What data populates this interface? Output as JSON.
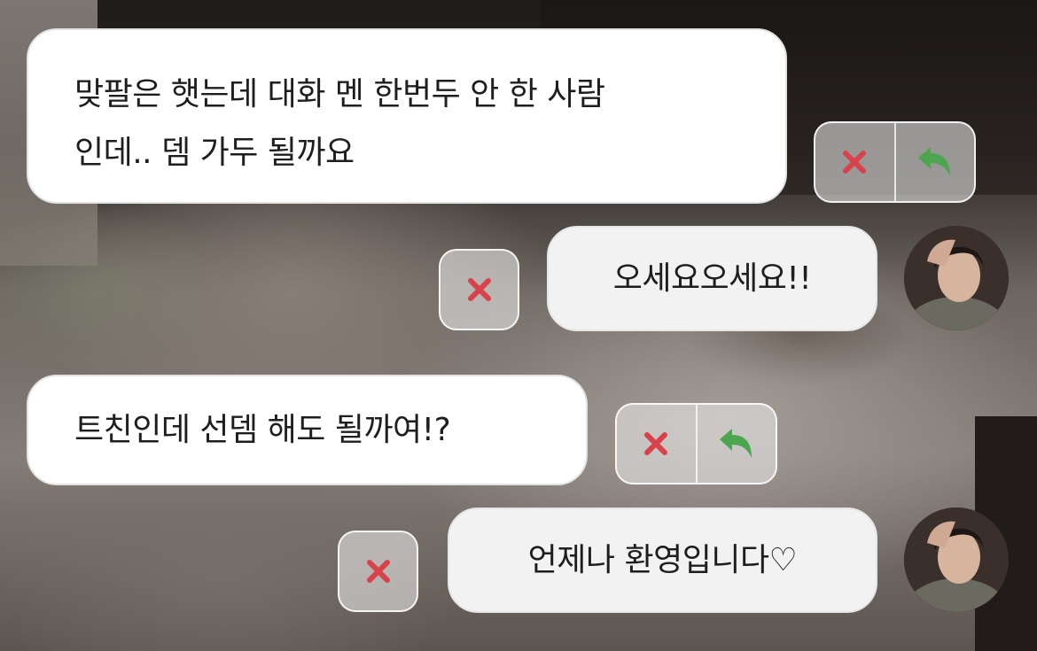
{
  "messages": [
    {
      "question": "맞팔은 햇는데 대화 멘 한번두 안 한 사람\n인데.. 뎀 가두 될까요",
      "answer": "오세요오세요!!"
    },
    {
      "question": "트친인데 선뎀 해도 될까여!?",
      "answer": "언제나 환영입니다♡"
    }
  ],
  "icons": {
    "delete": "close-icon",
    "reply": "reply-arrow-icon",
    "avatar": "profile-avatar"
  },
  "colors": {
    "delete_icon": "#d8434b",
    "reply_icon": "#4ca64f",
    "question_bubble": "#ffffff",
    "answer_bubble": "#f2f2f2"
  }
}
